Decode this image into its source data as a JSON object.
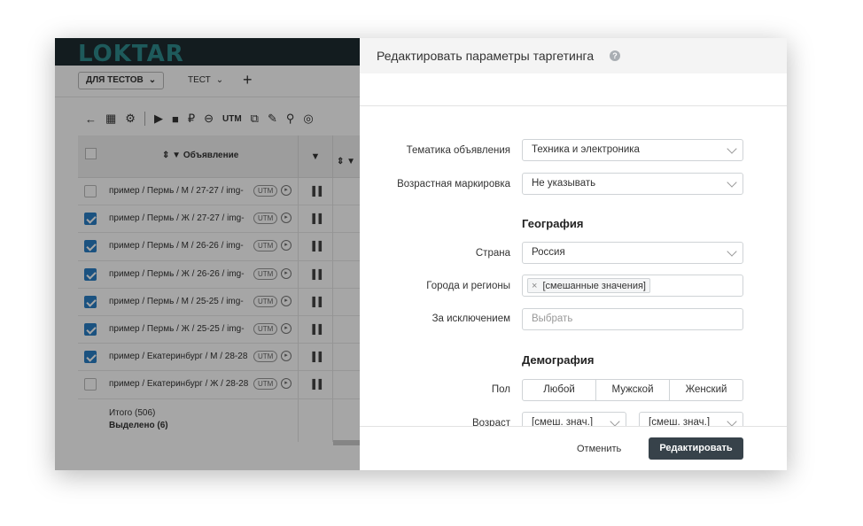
{
  "app": {
    "logo": "LOKTAR",
    "project_tab": "ДЛЯ ТЕСТОВ",
    "project_tab2": "ТЕСТ",
    "add": "+",
    "toolbar": {
      "back": "←",
      "settings": "⚙",
      "play": "▶",
      "stop": "■",
      "ruble": "₽",
      "minus": "⊖",
      "utm": "UTM",
      "copy": "⧉",
      "edit": "✎",
      "search": "⚲",
      "target": "◎"
    },
    "table": {
      "header_title": "Объявление",
      "header_sort": "⇕",
      "header_filter": "▼",
      "header_col2": "▼",
      "header_col3": "⇕ ▼",
      "utm_label": "UTM",
      "play_icon": "▸",
      "pause_icon": "▐▐",
      "rows": [
        {
          "name": "пример / Пермь / М / 27-27 / img-",
          "checked": false
        },
        {
          "name": "пример / Пермь / Ж / 27-27 / img-",
          "checked": true
        },
        {
          "name": "пример / Пермь / М / 26-26 / img-",
          "checked": true
        },
        {
          "name": "пример / Пермь / Ж / 26-26 / img-",
          "checked": true
        },
        {
          "name": "пример / Пермь / М / 25-25 / img-",
          "checked": true
        },
        {
          "name": "пример / Пермь / Ж / 25-25 / img-",
          "checked": true
        },
        {
          "name": "пример / Екатеринбург / М / 28-28",
          "checked": true
        },
        {
          "name": "пример / Екатеринбург / Ж / 28-28",
          "checked": false
        }
      ],
      "total": "Итого (506)",
      "selected": "Выделено (6)"
    }
  },
  "modal": {
    "title": "Редактировать параметры таргетинга",
    "help": "?",
    "fields": {
      "topic": {
        "label": "Тематика объявления",
        "value": "Техника и электроника"
      },
      "age_marking": {
        "label": "Возрастная маркировка",
        "value": "Не указывать"
      },
      "geo_heading": "География",
      "country": {
        "label": "Страна",
        "value": "Россия"
      },
      "cities": {
        "label": "Города и регионы",
        "tag": "[смешанные значения]",
        "tag_remove": "×"
      },
      "exclude": {
        "label": "За исключением",
        "placeholder": "Выбрать"
      },
      "demo_heading": "Демография",
      "gender": {
        "label": "Пол",
        "options": [
          "Любой",
          "Мужской",
          "Женский"
        ]
      },
      "age": {
        "label": "Возраст",
        "from": "[смеш. знач.]",
        "to": "[смеш. знач.]"
      }
    },
    "cancel": "Отменить",
    "submit": "Редактировать"
  }
}
